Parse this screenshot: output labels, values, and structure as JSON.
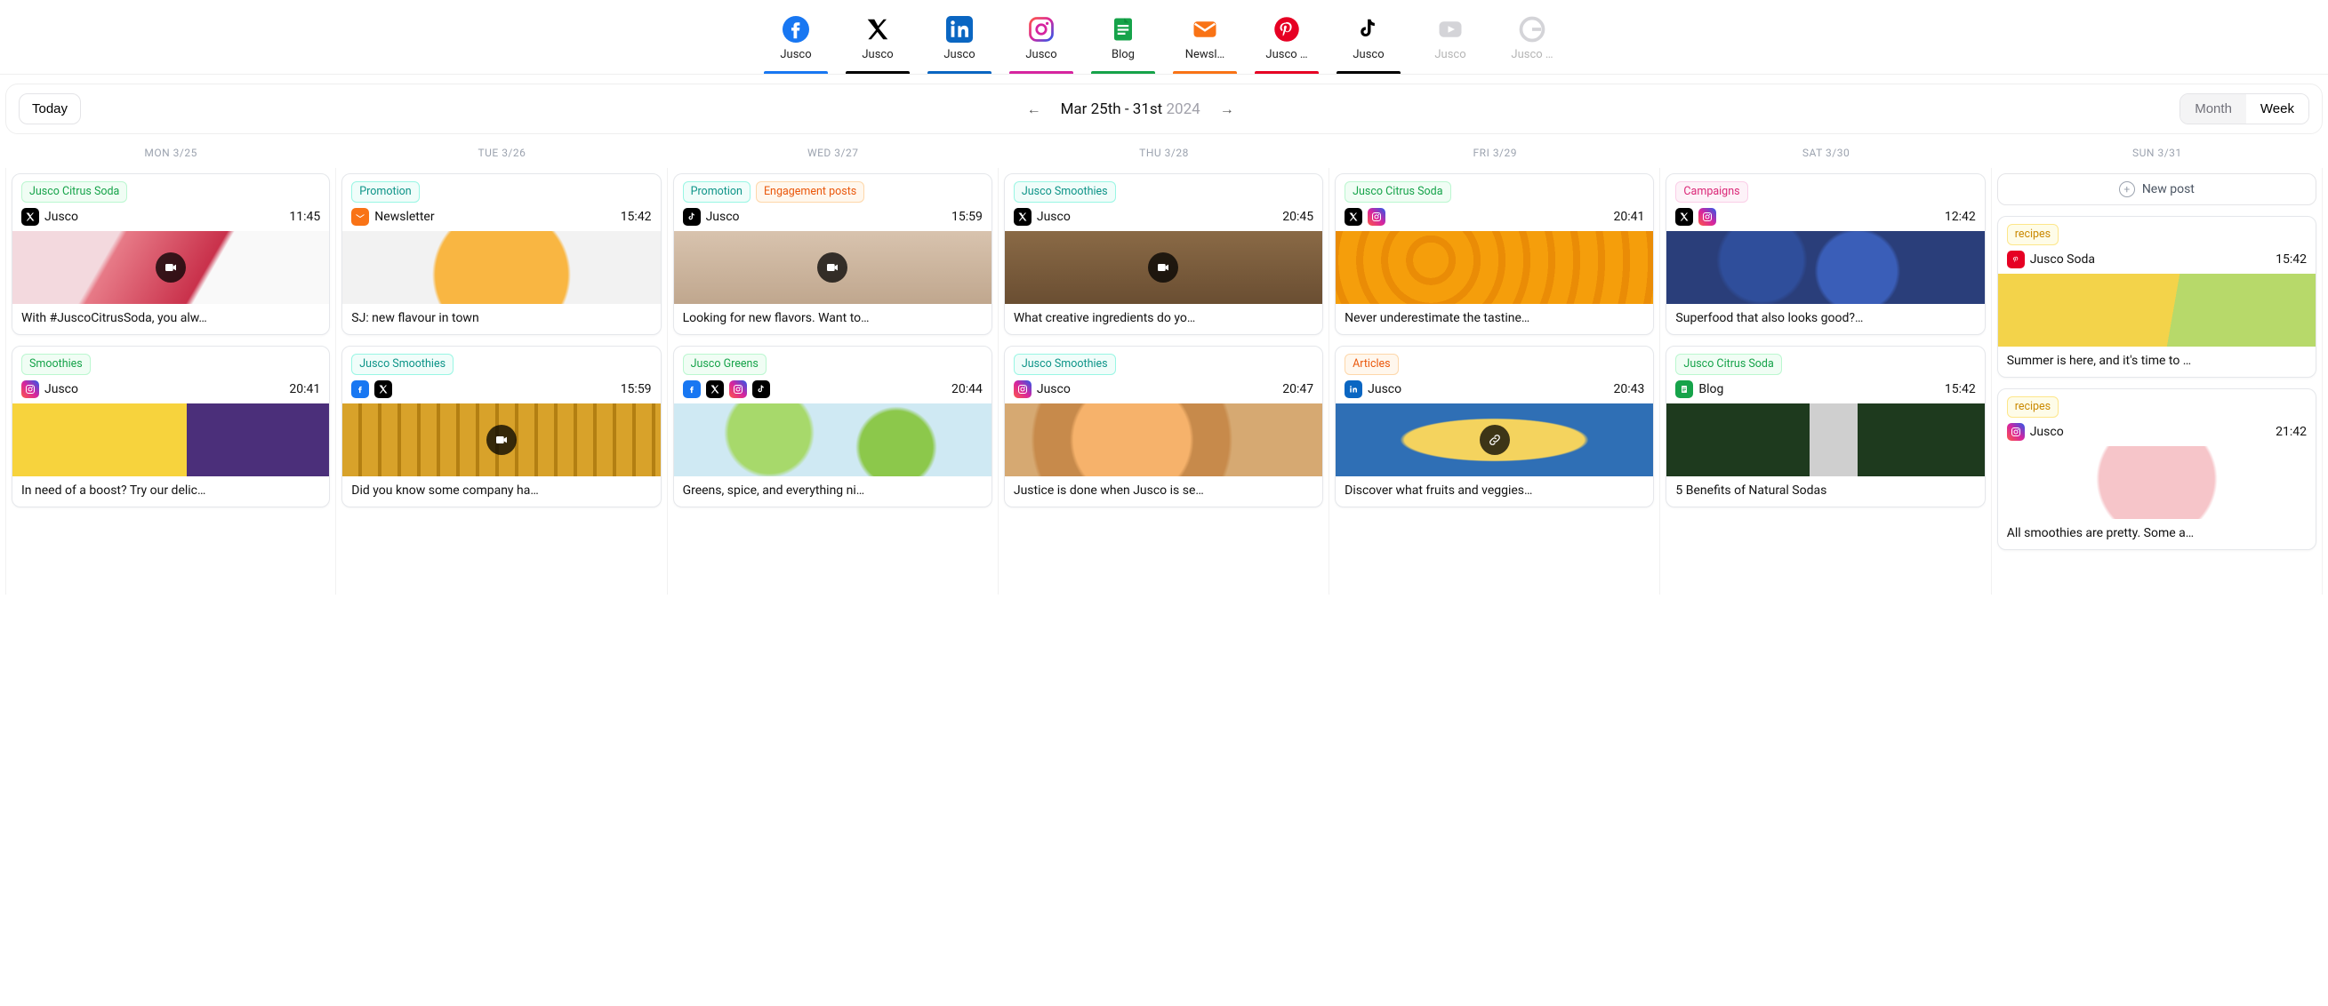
{
  "channels": [
    {
      "label": "Jusco",
      "type": "fb",
      "bar": "#1877f2",
      "active": true
    },
    {
      "label": "Jusco",
      "type": "x",
      "bar": "#000000",
      "active": true
    },
    {
      "label": "Jusco",
      "type": "in",
      "bar": "#0a66c2",
      "active": true
    },
    {
      "label": "Jusco",
      "type": "ig",
      "bar": "#d6249f",
      "active": true
    },
    {
      "label": "Blog",
      "type": "bl",
      "bar": "#16a34a",
      "active": true
    },
    {
      "label": "Newsl…",
      "type": "nl",
      "bar": "#f97316",
      "active": true
    },
    {
      "label": "Jusco …",
      "type": "pn",
      "bar": "#e60023",
      "active": true
    },
    {
      "label": "Jusco",
      "type": "tt",
      "bar": "#000000",
      "active": true
    },
    {
      "label": "Jusco",
      "type": "yt",
      "bar": "",
      "active": false
    },
    {
      "label": "Jusco …",
      "type": "gg",
      "bar": "",
      "active": false
    }
  ],
  "toolbar": {
    "today": "Today",
    "range": "Mar 25th - 31st",
    "year": "2024",
    "month": "Month",
    "week": "Week"
  },
  "days": [
    "MON 3/25",
    "TUE 3/26",
    "WED 3/27",
    "THU 3/28",
    "FRI 3/29",
    "SAT 3/30",
    "SUN 3/31"
  ],
  "newpost_label": "New post",
  "columns": [
    [
      {
        "tags": [
          {
            "text": "Jusco Citrus Soda",
            "c": "green"
          }
        ],
        "platforms": [
          "x"
        ],
        "account": "Jusco",
        "time": "11:45",
        "thumb": "t-cocktail",
        "overlay": "video",
        "caption": "With #JuscoCitrusSoda, you alw…"
      },
      {
        "tags": [
          {
            "text": "Smoothies",
            "c": "green"
          }
        ],
        "platforms": [
          "ig"
        ],
        "account": "Jusco",
        "time": "20:41",
        "thumb": "t-yellow",
        "caption": "In need of a boost? Try our delic…"
      }
    ],
    [
      {
        "tags": [
          {
            "text": "Promotion",
            "c": "teal"
          }
        ],
        "platforms": [
          "nl"
        ],
        "account": "Newsletter",
        "time": "15:42",
        "thumb": "t-juice",
        "caption": "SJ: new flavour in town"
      },
      {
        "tags": [
          {
            "text": "Jusco Smoothies",
            "c": "teal"
          }
        ],
        "platforms": [
          "fb",
          "x"
        ],
        "account": "",
        "time": "15:59",
        "thumb": "t-pine",
        "overlay": "video",
        "caption": "Did you know some company ha…"
      }
    ],
    [
      {
        "tags": [
          {
            "text": "Promotion",
            "c": "teal"
          },
          {
            "text": "Engagement posts",
            "c": "orange"
          }
        ],
        "platforms": [
          "tt"
        ],
        "account": "Jusco",
        "time": "15:59",
        "thumb": "t-face",
        "overlay": "video",
        "caption": "Looking for new flavors. Want to…"
      },
      {
        "tags": [
          {
            "text": "Jusco Greens",
            "c": "green"
          }
        ],
        "platforms": [
          "fb",
          "x",
          "ig",
          "tt"
        ],
        "account": "",
        "time": "20:44",
        "thumb": "t-limes",
        "caption": "Greens, spice, and everything ni…"
      }
    ],
    [
      {
        "tags": [
          {
            "text": "Jusco Smoothies",
            "c": "teal"
          }
        ],
        "platforms": [
          "x"
        ],
        "account": "Jusco",
        "time": "20:45",
        "thumb": "t-smooth",
        "overlay": "video",
        "caption": "What creative ingredients do yo…"
      },
      {
        "tags": [
          {
            "text": "Jusco Smoothies",
            "c": "teal"
          }
        ],
        "platforms": [
          "ig"
        ],
        "account": "Jusco",
        "time": "20:47",
        "thumb": "t-citrus",
        "caption": "Justice is done when Jusco is se…"
      }
    ],
    [
      {
        "tags": [
          {
            "text": "Jusco Citrus Soda",
            "c": "green"
          }
        ],
        "platforms": [
          "x",
          "ig"
        ],
        "account": "",
        "time": "20:41",
        "thumb": "t-orange",
        "caption": "Never underestimate the tastine…"
      },
      {
        "tags": [
          {
            "text": "Articles",
            "c": "orange"
          }
        ],
        "platforms": [
          "in"
        ],
        "account": "Jusco",
        "time": "20:43",
        "thumb": "t-banana",
        "overlay": "link",
        "caption": "Discover what fruits and veggies…"
      }
    ],
    [
      {
        "tags": [
          {
            "text": "Campaigns",
            "c": "pink"
          }
        ],
        "platforms": [
          "x",
          "ig"
        ],
        "account": "",
        "time": "12:42",
        "thumb": "t-blue",
        "caption": "Superfood that also looks good?…"
      },
      {
        "tags": [
          {
            "text": "Jusco Citrus Soda",
            "c": "green"
          }
        ],
        "platforms": [
          "bl"
        ],
        "account": "Blog",
        "time": "15:42",
        "thumb": "t-detox",
        "caption": "5 Benefits of Natural Sodas"
      }
    ],
    [
      {
        "tags": [
          {
            "text": "recipes",
            "c": "yellow"
          }
        ],
        "platforms": [
          "pn"
        ],
        "account": "Jusco Soda",
        "time": "15:42",
        "thumb": "t-lemon",
        "caption": "Summer is here, and it's time to …"
      },
      {
        "tags": [
          {
            "text": "recipes",
            "c": "yellow"
          }
        ],
        "platforms": [
          "ig"
        ],
        "account": "Jusco",
        "time": "21:42",
        "thumb": "t-parfait",
        "caption": "All smoothies are pretty. Some a…"
      }
    ]
  ]
}
